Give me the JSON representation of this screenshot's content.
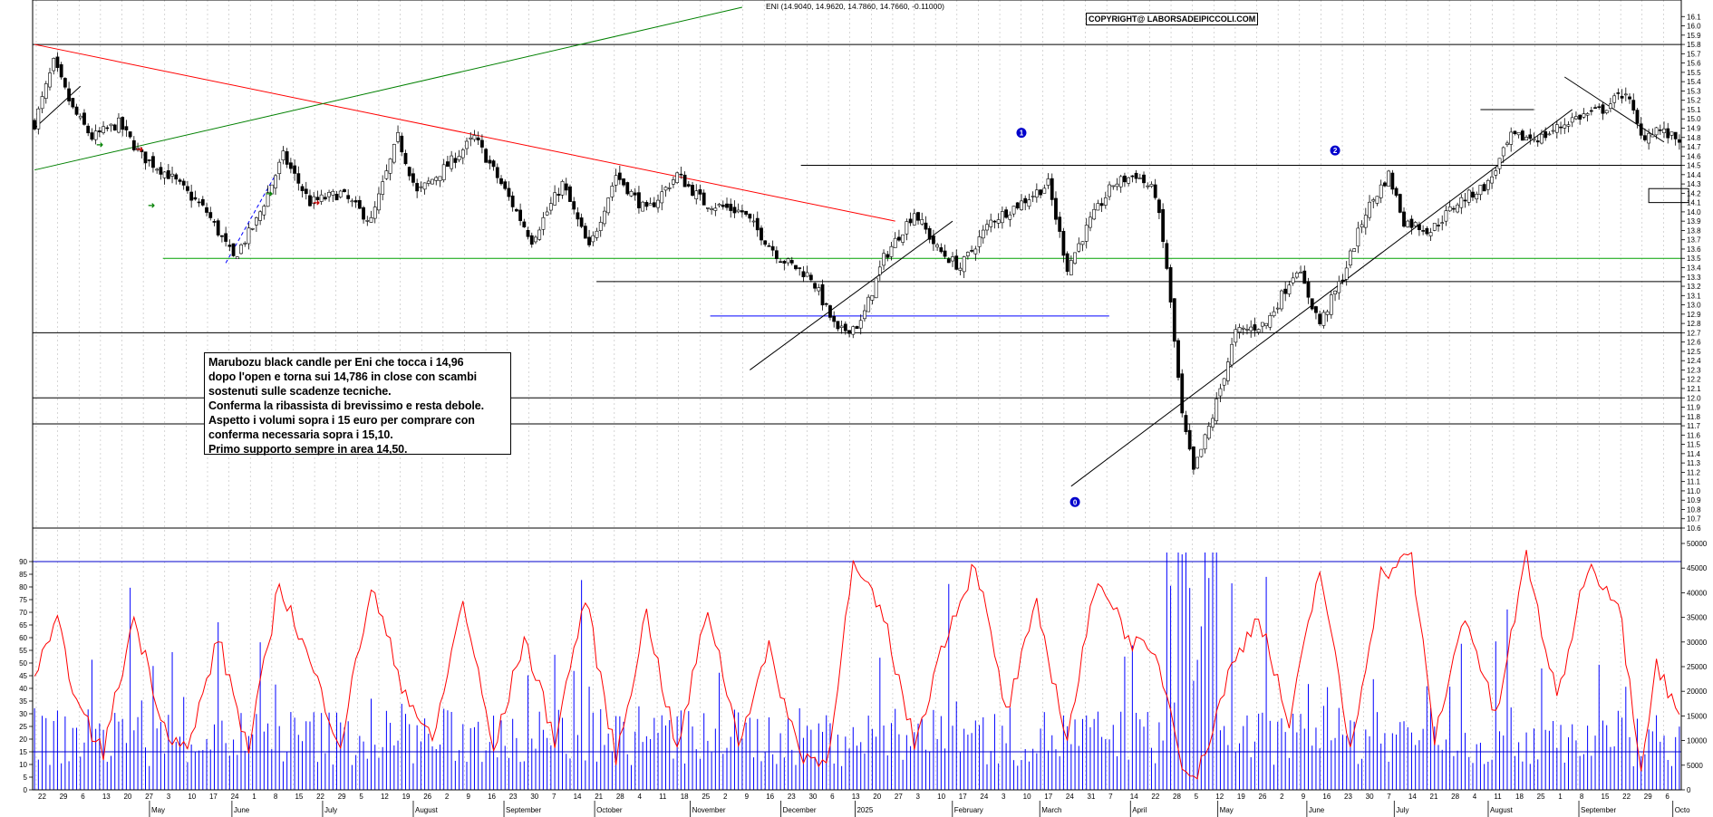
{
  "chart_data": [
    {
      "type": "candlestick",
      "ohlc_caption": "ENI (14.9040, 14.9620, 14.7860, 14.7660, -0.11000)",
      "watermark": "COPYRIGHT@ LABORSADEIPICCOLI.COM",
      "ylim": [
        10.6,
        16.2
      ],
      "yticks": [
        10.6,
        10.7,
        10.8,
        10.9,
        11.0,
        11.1,
        11.2,
        11.3,
        11.4,
        11.5,
        11.6,
        11.7,
        11.8,
        11.9,
        12.0,
        12.1,
        12.2,
        12.3,
        12.4,
        12.5,
        12.6,
        12.7,
        12.8,
        12.9,
        13.0,
        13.1,
        13.2,
        13.3,
        13.4,
        13.5,
        13.6,
        13.7,
        13.8,
        13.9,
        14.0,
        14.1,
        14.2,
        14.3,
        14.4,
        14.5,
        14.6,
        14.7,
        14.8,
        14.9,
        15.0,
        15.1,
        15.2,
        15.3,
        15.4,
        15.5,
        15.6,
        15.7,
        15.8,
        15.9,
        16.0,
        16.1
      ],
      "x_date_labels": [
        "22",
        "29",
        "6",
        "13",
        "20",
        "27",
        "3",
        "10",
        "17",
        "24",
        "1",
        "8",
        "15",
        "22",
        "29",
        "5",
        "12",
        "19",
        "26",
        "2",
        "9",
        "16",
        "23",
        "30",
        "7",
        "14",
        "21",
        "28",
        "4",
        "11",
        "18",
        "25",
        "2",
        "9",
        "16",
        "23",
        "30",
        "6",
        "13",
        "20",
        "27",
        "3",
        "10",
        "17",
        "24",
        "3",
        "10",
        "17",
        "24",
        "31",
        "7",
        "14",
        "22",
        "28",
        "5",
        "12",
        "19",
        "26",
        "2",
        "9",
        "16",
        "23",
        "30",
        "7",
        "14",
        "21",
        "28",
        "4",
        "11",
        "18",
        "25",
        "1",
        "8",
        "15",
        "22",
        "29",
        "6"
      ],
      "month_labels": [
        "May",
        "June",
        "July",
        "August",
        "September",
        "October",
        "November",
        "December",
        "2025",
        "February",
        "March",
        "April",
        "May",
        "June",
        "July",
        "August",
        "September",
        "Octo"
      ],
      "horizontal_levels": [
        15.8,
        14.5,
        13.5,
        13.25,
        12.88,
        12.7,
        12.0,
        11.72
      ],
      "level_colors": {
        "15.8": "#000000",
        "14.5": "#000000",
        "13.5": "#00a000",
        "13.25": "#000000",
        "12.88": "#0000ff",
        "12.7": "#000000",
        "12.0": "#000000",
        "11.72": "#000000"
      },
      "wave_labels": [
        "1",
        "2",
        "0"
      ],
      "series": [
        {
          "name": "ENI",
          "anchors": [
            {
              "i": 0,
              "c": 14.95
            },
            {
              "i": 5,
              "c": 15.6
            },
            {
              "i": 10,
              "c": 15.1
            },
            {
              "i": 15,
              "c": 14.8
            },
            {
              "i": 22,
              "c": 14.95
            },
            {
              "i": 28,
              "c": 14.6
            },
            {
              "i": 35,
              "c": 14.4
            },
            {
              "i": 45,
              "c": 14.0
            },
            {
              "i": 52,
              "c": 13.5
            },
            {
              "i": 58,
              "c": 13.9
            },
            {
              "i": 65,
              "c": 14.6
            },
            {
              "i": 72,
              "c": 14.1
            },
            {
              "i": 80,
              "c": 14.2
            },
            {
              "i": 88,
              "c": 13.9
            },
            {
              "i": 95,
              "c": 14.8
            },
            {
              "i": 100,
              "c": 14.2
            },
            {
              "i": 108,
              "c": 14.5
            },
            {
              "i": 115,
              "c": 14.8
            },
            {
              "i": 122,
              "c": 14.3
            },
            {
              "i": 130,
              "c": 13.7
            },
            {
              "i": 138,
              "c": 14.3
            },
            {
              "i": 145,
              "c": 13.6
            },
            {
              "i": 152,
              "c": 14.4
            },
            {
              "i": 160,
              "c": 14.0
            },
            {
              "i": 168,
              "c": 14.4
            },
            {
              "i": 175,
              "c": 14.1
            },
            {
              "i": 185,
              "c": 14.0
            },
            {
              "i": 195,
              "c": 13.5
            },
            {
              "i": 203,
              "c": 13.3
            },
            {
              "i": 210,
              "c": 12.7
            },
            {
              "i": 216,
              "c": 12.8
            },
            {
              "i": 222,
              "c": 13.5
            },
            {
              "i": 230,
              "c": 14.0
            },
            {
              "i": 236,
              "c": 13.6
            },
            {
              "i": 242,
              "c": 13.4
            },
            {
              "i": 250,
              "c": 13.9
            },
            {
              "i": 258,
              "c": 14.1
            },
            {
              "i": 265,
              "c": 14.3
            },
            {
              "i": 270,
              "c": 13.4
            },
            {
              "i": 276,
              "c": 13.9
            },
            {
              "i": 282,
              "c": 14.3
            },
            {
              "i": 288,
              "c": 14.4
            },
            {
              "i": 293,
              "c": 14.2
            },
            {
              "i": 296,
              "c": 13.4
            },
            {
              "i": 300,
              "c": 11.8
            },
            {
              "i": 303,
              "c": 11.2
            },
            {
              "i": 308,
              "c": 11.8
            },
            {
              "i": 314,
              "c": 12.7
            },
            {
              "i": 322,
              "c": 12.8
            },
            {
              "i": 330,
              "c": 13.4
            },
            {
              "i": 336,
              "c": 12.8
            },
            {
              "i": 342,
              "c": 13.3
            },
            {
              "i": 348,
              "c": 14.0
            },
            {
              "i": 354,
              "c": 14.4
            },
            {
              "i": 358,
              "c": 13.9
            },
            {
              "i": 365,
              "c": 13.8
            },
            {
              "i": 372,
              "c": 14.1
            },
            {
              "i": 380,
              "c": 14.3
            },
            {
              "i": 386,
              "c": 14.8
            },
            {
              "i": 394,
              "c": 14.8
            },
            {
              "i": 402,
              "c": 15.0
            },
            {
              "i": 410,
              "c": 15.1
            },
            {
              "i": 416,
              "c": 15.3
            },
            {
              "i": 420,
              "c": 14.8
            },
            {
              "i": 424,
              "c": 14.9
            },
            {
              "i": 428,
              "c": 14.8
            },
            {
              "i": 430,
              "c": 14.79
            }
          ]
        }
      ]
    },
    {
      "type": "bar+line",
      "left_yticks": [
        0,
        5,
        10,
        15,
        20,
        25,
        30,
        35,
        40,
        45,
        50,
        55,
        60,
        65,
        70,
        75,
        80,
        85,
        90
      ],
      "right_yticks": [
        "0",
        "5000",
        "10000",
        "15000",
        "20000",
        "25000",
        "30000",
        "35000",
        "40000",
        "45000",
        "50000"
      ],
      "reference_levels": [
        90,
        15
      ],
      "series": [
        {
          "name": "Volume",
          "color": "#0000ff"
        },
        {
          "name": "Oscillator",
          "color": "#ff0000",
          "anchors": [
            {
              "i": 0,
              "v": 45
            },
            {
              "i": 6,
              "v": 65
            },
            {
              "i": 12,
              "v": 30
            },
            {
              "i": 18,
              "v": 15
            },
            {
              "i": 26,
              "v": 68
            },
            {
              "i": 34,
              "v": 25
            },
            {
              "i": 40,
              "v": 15
            },
            {
              "i": 48,
              "v": 60
            },
            {
              "i": 56,
              "v": 15
            },
            {
              "i": 64,
              "v": 82
            },
            {
              "i": 72,
              "v": 50
            },
            {
              "i": 80,
              "v": 18
            },
            {
              "i": 88,
              "v": 80
            },
            {
              "i": 96,
              "v": 42
            },
            {
              "i": 104,
              "v": 18
            },
            {
              "i": 112,
              "v": 75
            },
            {
              "i": 120,
              "v": 15
            },
            {
              "i": 128,
              "v": 60
            },
            {
              "i": 136,
              "v": 20
            },
            {
              "i": 144,
              "v": 76
            },
            {
              "i": 152,
              "v": 12
            },
            {
              "i": 160,
              "v": 70
            },
            {
              "i": 168,
              "v": 15
            },
            {
              "i": 176,
              "v": 72
            },
            {
              "i": 184,
              "v": 20
            },
            {
              "i": 192,
              "v": 55
            },
            {
              "i": 200,
              "v": 15
            },
            {
              "i": 207,
              "v": 10
            },
            {
              "i": 214,
              "v": 88
            },
            {
              "i": 222,
              "v": 68
            },
            {
              "i": 230,
              "v": 18
            },
            {
              "i": 238,
              "v": 60
            },
            {
              "i": 246,
              "v": 90
            },
            {
              "i": 254,
              "v": 30
            },
            {
              "i": 262,
              "v": 72
            },
            {
              "i": 270,
              "v": 20
            },
            {
              "i": 278,
              "v": 85
            },
            {
              "i": 286,
              "v": 60
            },
            {
              "i": 294,
              "v": 50
            },
            {
              "i": 300,
              "v": 12
            },
            {
              "i": 304,
              "v": 5
            },
            {
              "i": 312,
              "v": 45
            },
            {
              "i": 320,
              "v": 70
            },
            {
              "i": 328,
              "v": 25
            },
            {
              "i": 336,
              "v": 88
            },
            {
              "i": 344,
              "v": 15
            },
            {
              "i": 352,
              "v": 85
            },
            {
              "i": 360,
              "v": 92
            },
            {
              "i": 366,
              "v": 20
            },
            {
              "i": 374,
              "v": 70
            },
            {
              "i": 382,
              "v": 28
            },
            {
              "i": 390,
              "v": 92
            },
            {
              "i": 398,
              "v": 35
            },
            {
              "i": 406,
              "v": 89
            },
            {
              "i": 414,
              "v": 75
            },
            {
              "i": 420,
              "v": 10
            },
            {
              "i": 424,
              "v": 50
            },
            {
              "i": 428,
              "v": 35
            },
            {
              "i": 430,
              "v": 30
            }
          ]
        }
      ]
    }
  ],
  "note": {
    "lines": [
      "Marubozu black candle per Eni che tocca i 14,96",
      "dopo l'open e torna sui 14,786 in close con scambi",
      "sostenuti sulle scadenze tecniche.",
      "Conferma la ribassista di brevissimo e resta debole.",
      "Aspetto i volumi sopra i 15 euro per comprare con",
      "conferma necessaria sopra i 15,10.",
      "Primo supporto sempre in area 14,50."
    ]
  }
}
